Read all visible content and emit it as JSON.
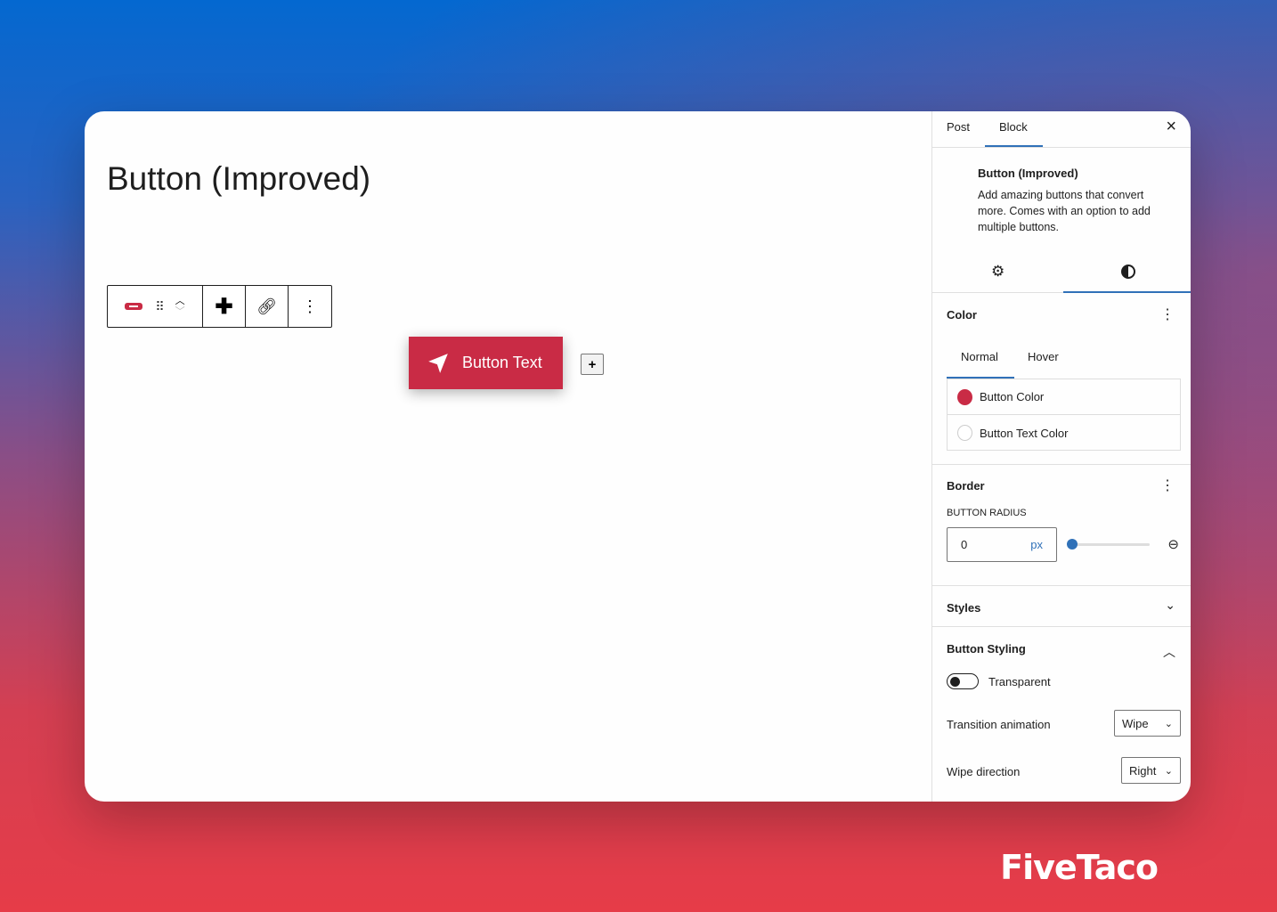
{
  "editor": {
    "title": "Button (Improved)",
    "button_text": "Button Text",
    "add_label": "+"
  },
  "sidebar": {
    "tabs": [
      "Post",
      "Block"
    ],
    "active_tab": "Block",
    "close": "×",
    "block": {
      "name": "Button (Improved)",
      "description": "Add amazing buttons that convert more. Comes with an option to add multiple buttons."
    },
    "color": {
      "title": "Color",
      "tabs": [
        "Normal",
        "Hover"
      ],
      "active": "Normal",
      "items": [
        {
          "label": "Button Color",
          "swatch": "#c92b45"
        },
        {
          "label": "Button Text Color",
          "swatch": "#ffffff"
        }
      ]
    },
    "border": {
      "title": "Border",
      "radius_label": "BUTTON RADIUS",
      "radius_value": "0",
      "unit": "px",
      "slider_value": 0
    },
    "styles": {
      "title": "Styles"
    },
    "button_styling": {
      "title": "Button Styling",
      "transparent_label": "Transparent",
      "transparent_on": false,
      "transition_label": "Transition animation",
      "transition_value": "Wipe",
      "direction_label": "Wipe direction",
      "direction_value": "Right"
    }
  },
  "brand": {
    "logo": "FiveTaco"
  },
  "colors": {
    "accent": "#c92b45",
    "wp_blue": "#3071b8"
  }
}
